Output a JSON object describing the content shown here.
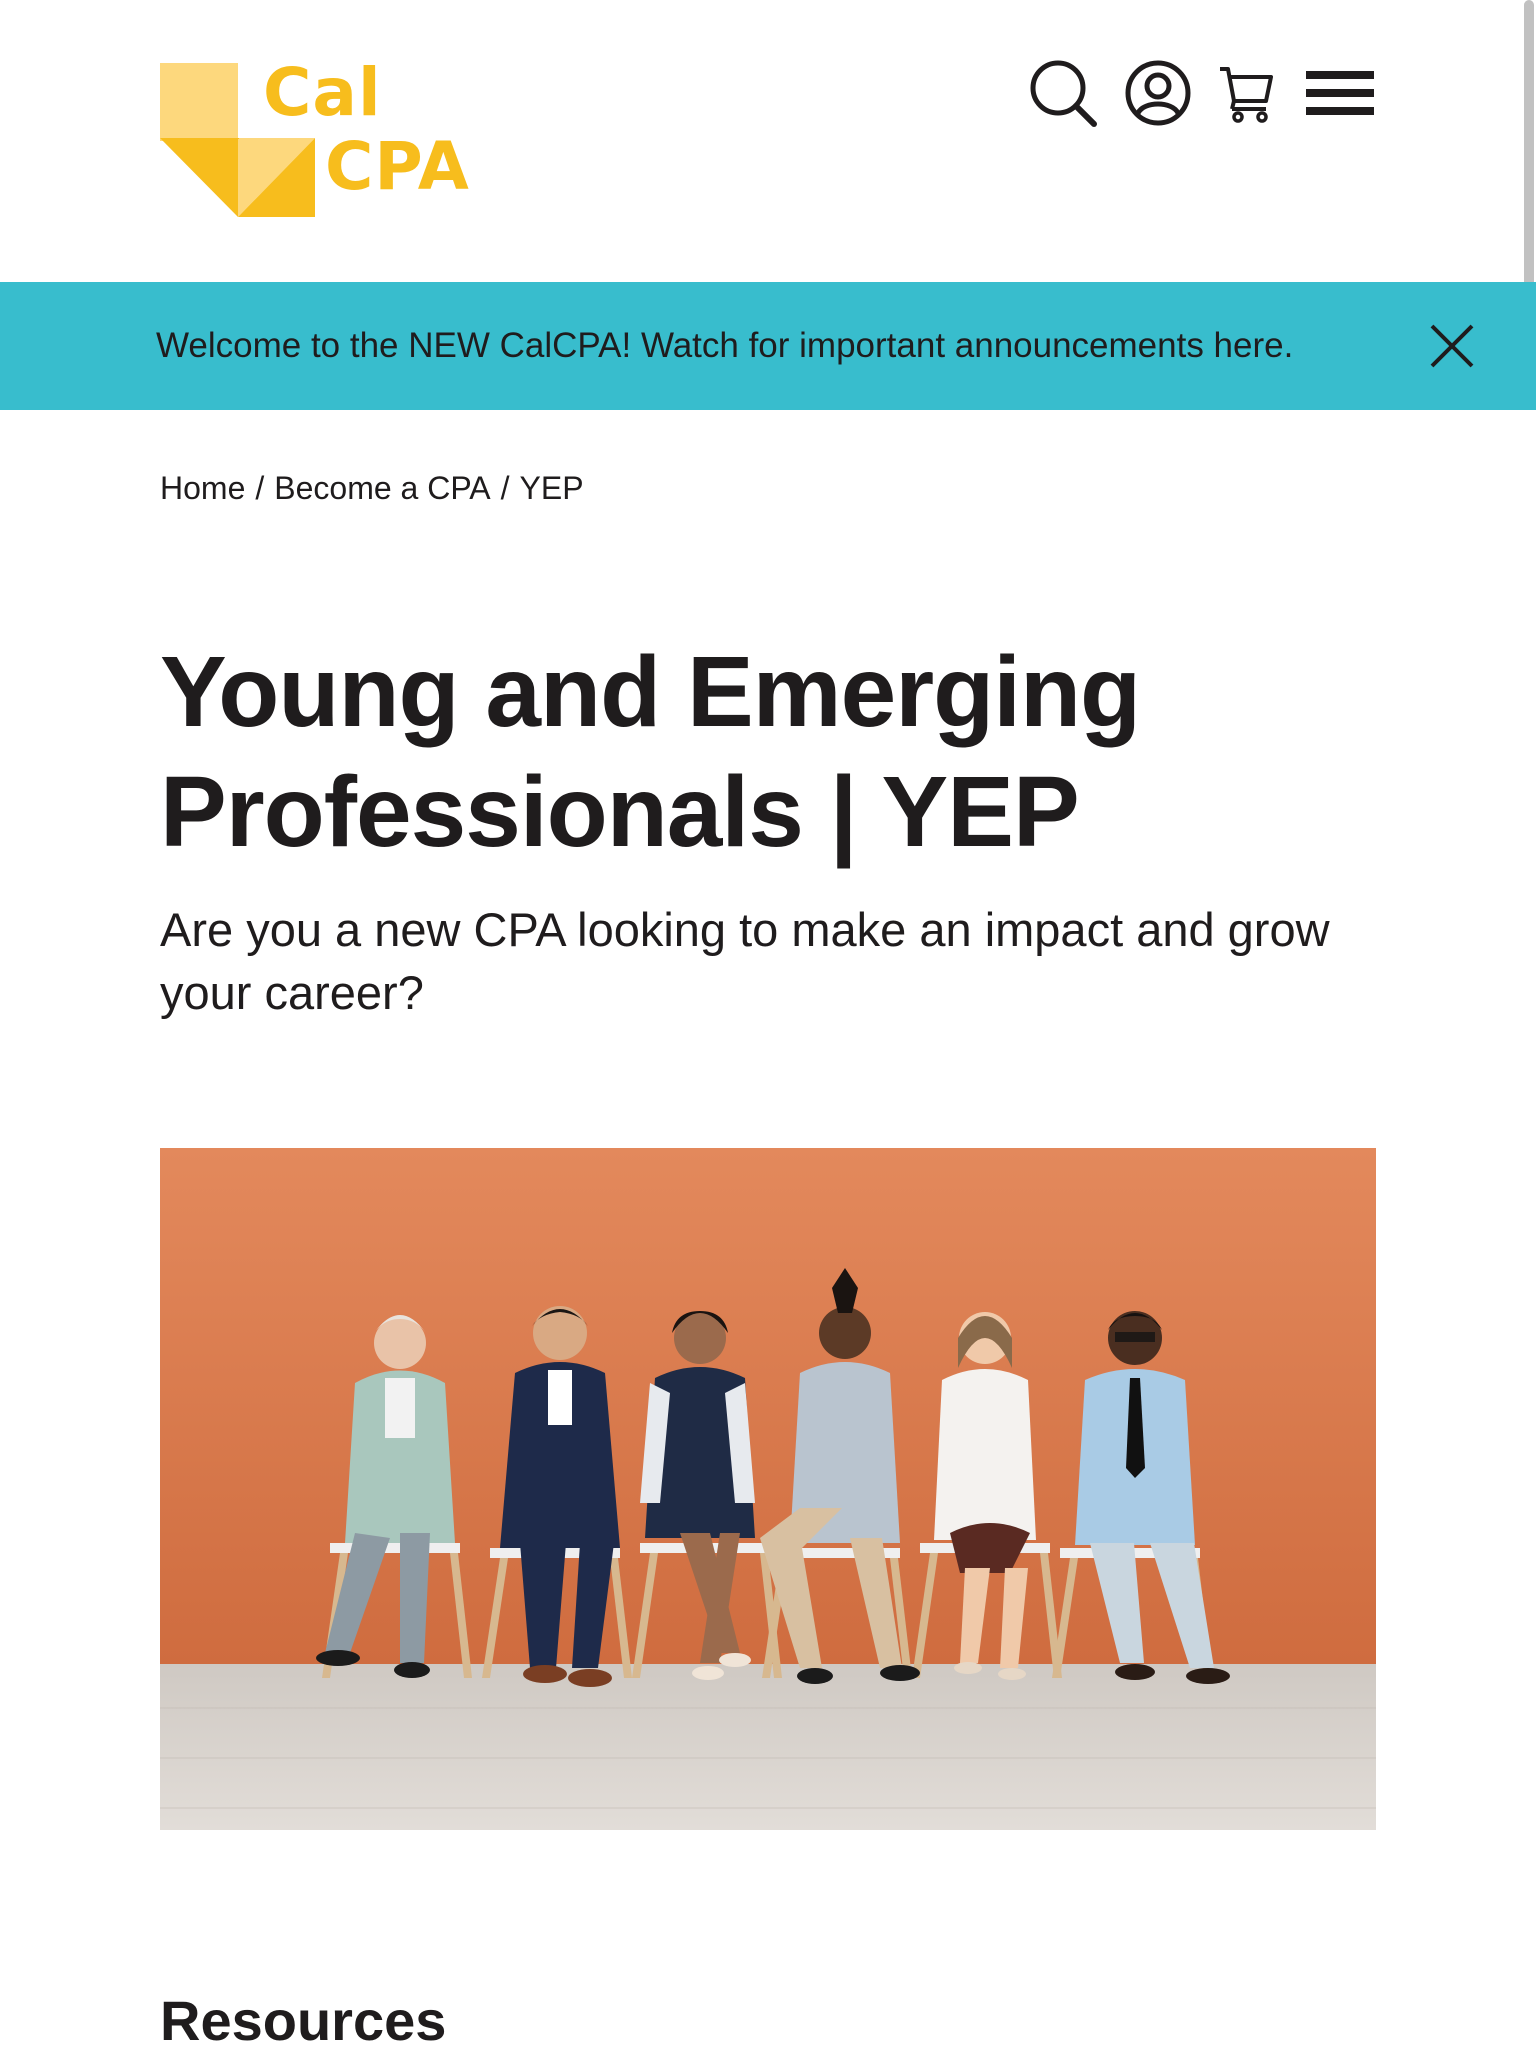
{
  "header": {
    "logo": {
      "line1": "Cal",
      "line2": "CPA"
    },
    "icons": [
      "search-icon",
      "account-icon",
      "cart-icon",
      "menu-icon"
    ]
  },
  "banner": {
    "text": "Welcome to the NEW CalCPA! Watch for important announcements here."
  },
  "breadcrumb": {
    "items": [
      "Home",
      "Become a CPA",
      "YEP"
    ],
    "separator": "/"
  },
  "page": {
    "title": "Young and Emerging Professionals | YEP",
    "subtitle": "Are you a new CPA looking to make an impact and grow your career?"
  },
  "sections": {
    "resources_heading": "Resources"
  },
  "colors": {
    "brand_yellow": "#f7bd1d",
    "banner_teal": "#38bdcd",
    "text_dark": "#1f1c1d",
    "hero_wall": "#d8774a",
    "hero_floor": "#d9d4cf"
  }
}
